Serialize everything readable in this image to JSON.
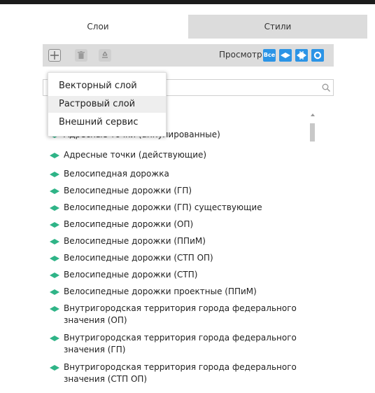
{
  "tabs": {
    "layers": "Слои",
    "styles": "Стили"
  },
  "toolbar": {
    "add_icon": "plus-icon",
    "delete_icon": "trash-icon",
    "recycle_icon": "recycle-icon",
    "preview_label": "Просмотр:",
    "preview_all": "Все"
  },
  "search": {
    "value": "",
    "placeholder": ""
  },
  "add_menu": {
    "items": [
      "Векторный слой",
      "Растровый слой",
      "Внешний сервис"
    ],
    "highlighted": "Растровый слой"
  },
  "layers": [
    "Адресные точки (аннулированные)",
    "Адресные точки (действующие)",
    "Велосипедная дорожка",
    "Велосипедные дорожки (ГП)",
    "Велосипедные дорожки (ГП) существующие",
    "Велосипедные дорожки (ОП)",
    "Велосипедные дорожки (ППиМ)",
    "Велосипедные дорожки (СТП ОП)",
    "Велосипедные дорожки (СТП)",
    "Велосипедные дорожки проектные (ППиМ)",
    "Внутригородская территория города федерального значения (ОП)",
    "Внутригородская территория города федерального значения (ГП)",
    "Внутригородская территория города федерального значения (СТП ОП)"
  ],
  "colors": {
    "accent": "#2b94e6",
    "layer_icon": "#2fb487",
    "tab_inactive": "#dcdcdc"
  }
}
